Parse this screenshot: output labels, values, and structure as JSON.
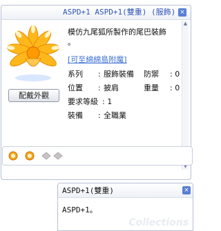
{
  "item_window": {
    "title": "ASPD+1 ASPD+1(雙重) (服飾)",
    "close_label": "×",
    "look_button_label": "配戴外觀",
    "description_line1": "模仿九尾狐所製作的尾巴裝飾",
    "description_line2": "。",
    "link_text": "[可至綿綿島附魔]",
    "props": [
      {
        "label": "系列",
        "value": "服飾裝備",
        "label2": "防禦",
        "value2": "0"
      },
      {
        "label": "位置",
        "value": "披肩",
        "label2": "重量",
        "value2": "0"
      },
      {
        "label": "要求等級",
        "value": "1"
      },
      {
        "label": "裝備",
        "value": "全職業"
      }
    ],
    "colon": ":"
  },
  "tooltip_window": {
    "title": "ASPD+1(雙重)",
    "body": "ASPD+1。",
    "watermark": "Collections",
    "close_label": "×"
  },
  "card_slots": [
    "orb-slot-icon",
    "orb-slot-icon",
    "empty-slot-icon",
    "empty-slot-icon"
  ],
  "colors": {
    "accent": "#3255b8",
    "link": "#3b6fd1",
    "border": "#b6bfd3"
  }
}
